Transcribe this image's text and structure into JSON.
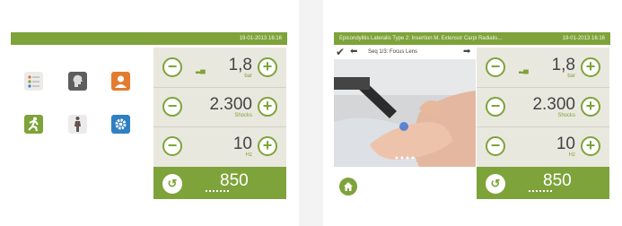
{
  "colors": {
    "accent": "#7ea33a",
    "panel": "#e9e8df"
  },
  "left_screen": {
    "status": {
      "timestamp": "19-01-2013 16:16"
    },
    "menu_icons": [
      "checklist-icon",
      "head-anatomy-icon",
      "user-profile-icon",
      "runner-icon",
      "body-anatomy-icon",
      "settings-icon"
    ],
    "controls": [
      {
        "value": "1,8",
        "unit": "bar",
        "icon": "pressure-bars-icon"
      },
      {
        "value": "2.300",
        "unit": "Shocks"
      },
      {
        "value": "10",
        "unit": "Hz"
      }
    ],
    "counter": {
      "value": "850"
    }
  },
  "right_screen": {
    "status": {
      "title": "Epicondylitis Lateralis Type 2: Insertion M. Extensor Carpi Radialis...",
      "timestamp": "19-01-2013 16:16"
    },
    "sequence": {
      "label": "Seq 1/3: Focus Lens"
    },
    "controls": [
      {
        "value": "1,8",
        "unit": "bar",
        "icon": "pressure-bars-icon"
      },
      {
        "value": "2.300",
        "unit": "Shocks"
      },
      {
        "value": "10",
        "unit": "Hz"
      }
    ],
    "counter": {
      "value": "850"
    }
  }
}
